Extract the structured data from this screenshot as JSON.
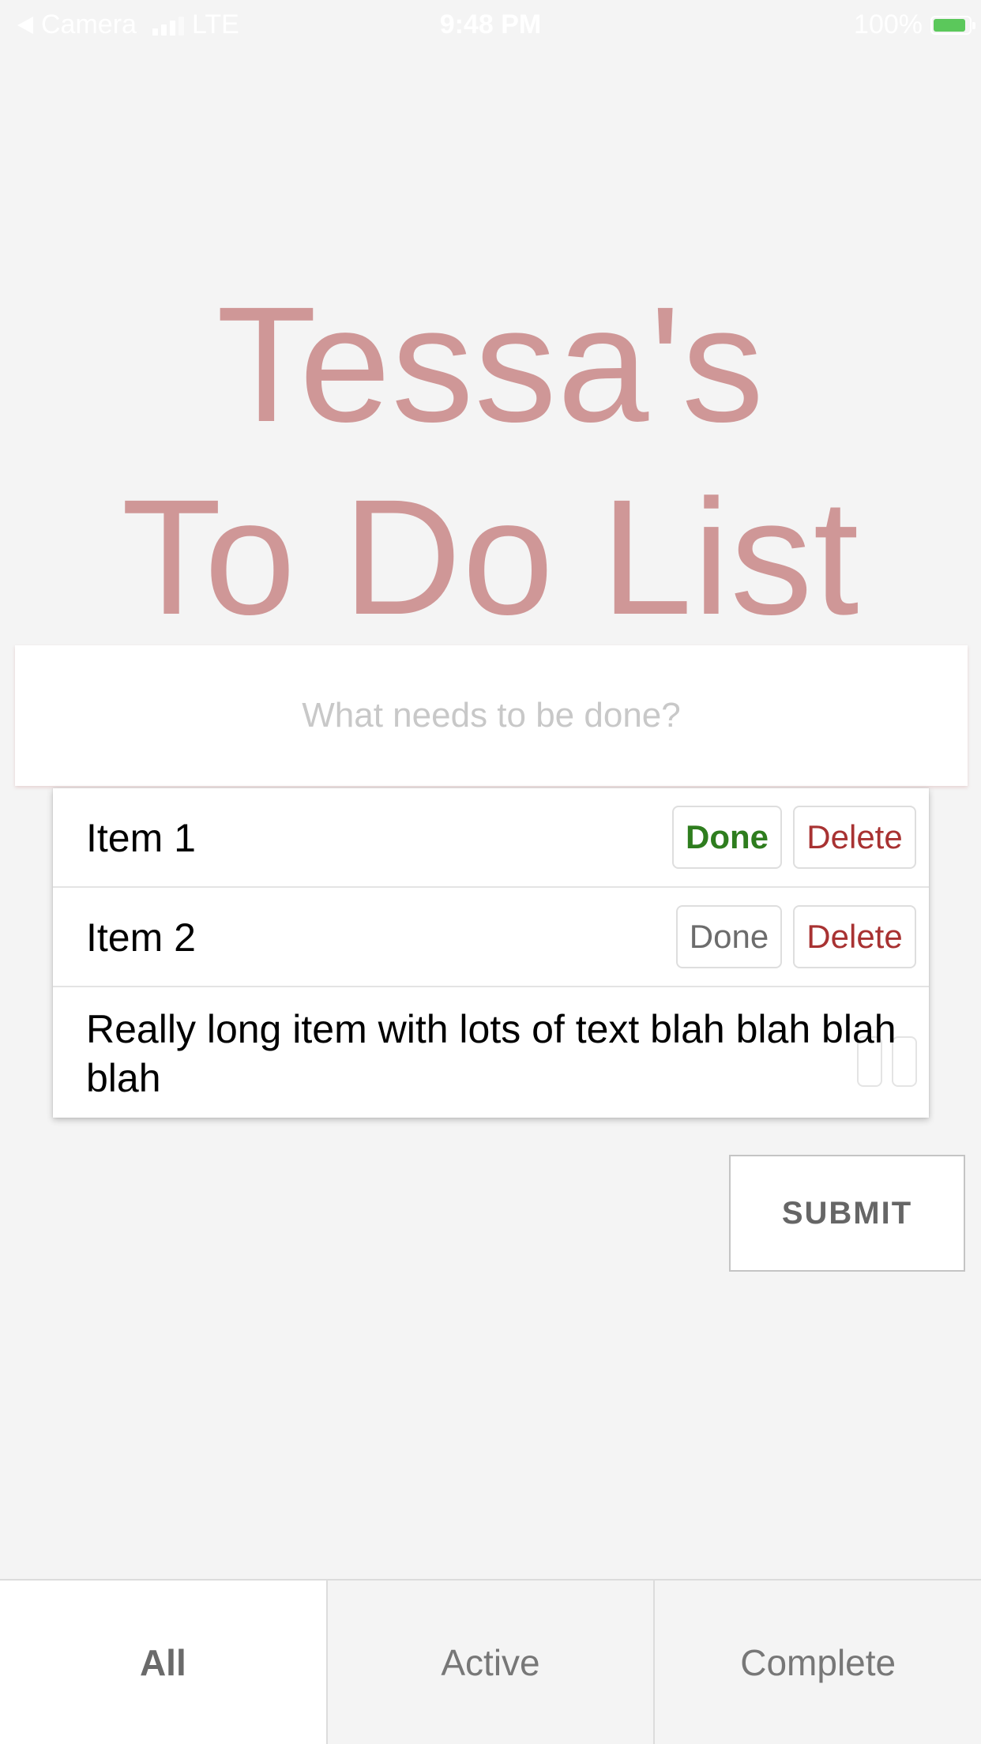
{
  "status_bar": {
    "back_label": "Camera",
    "network": "LTE",
    "time": "9:48 PM",
    "battery_percent": "100%",
    "battery_level": 0.9,
    "battery_color": "#5bc85b"
  },
  "title": {
    "line1": "Tessa's",
    "line2": "To Do List",
    "color": "#cf9797"
  },
  "input": {
    "placeholder": "What needs to be done?",
    "value": ""
  },
  "items": [
    {
      "text": "Item 1",
      "done_label": "Done",
      "delete_label": "Delete",
      "done_state": "active"
    },
    {
      "text": "Item 2",
      "done_label": "Done",
      "delete_label": "Delete",
      "done_state": "inactive"
    },
    {
      "text": "Really long item with lots of text blah blah blah blah"
    }
  ],
  "submit": {
    "label": "SUBMIT"
  },
  "tabs": [
    {
      "label": "All",
      "active": true
    },
    {
      "label": "Active",
      "active": false
    },
    {
      "label": "Complete",
      "active": false
    }
  ],
  "colors": {
    "done_active": "#2e7d1e",
    "delete": "#a83232",
    "background": "#f4f4f4"
  }
}
